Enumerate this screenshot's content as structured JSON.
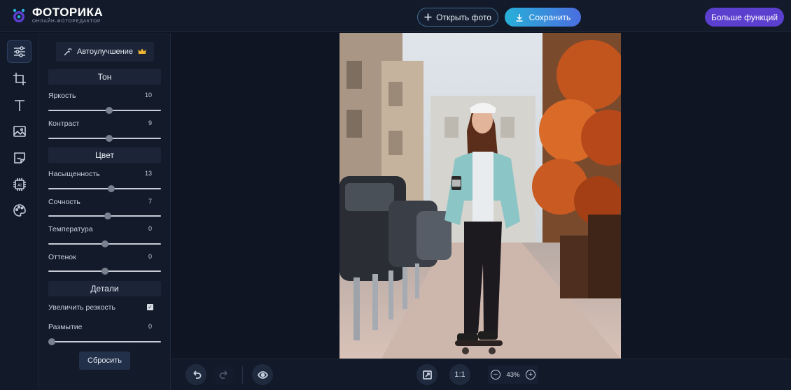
{
  "brand": {
    "title": "ФОТОРИКА",
    "subtitle": "ОНЛАЙН-ФОТОРЕДАКТОР"
  },
  "header": {
    "open_label": "Открыть фото",
    "save_label": "Сохранить",
    "more_label": "Больше функций"
  },
  "tools": [
    {
      "name": "adjustments",
      "icon": "sliders-icon",
      "active": true
    },
    {
      "name": "crop",
      "icon": "crop-icon"
    },
    {
      "name": "text",
      "icon": "text-icon"
    },
    {
      "name": "image",
      "icon": "image-icon"
    },
    {
      "name": "sticker",
      "icon": "sticker-icon"
    },
    {
      "name": "ai",
      "icon": "ai-chip-icon"
    },
    {
      "name": "effects",
      "icon": "palette-icon"
    }
  ],
  "panel": {
    "auto_label": "Автоулучшение",
    "sections": {
      "tone": "Тон",
      "color": "Цвет",
      "details": "Детали"
    },
    "controls": {
      "brightness": {
        "label": "Яркость",
        "value": 10,
        "fraction": 0.54
      },
      "contrast": {
        "label": "Контраст",
        "value": 9,
        "fraction": 0.54
      },
      "saturation": {
        "label": "Насыщенность",
        "value": 13,
        "fraction": 0.56
      },
      "vibrance": {
        "label": "Сочность",
        "value": 7,
        "fraction": 0.53
      },
      "temperature": {
        "label": "Температура",
        "value": 0,
        "fraction": 0.5
      },
      "tint": {
        "label": "Оттенок",
        "value": 0,
        "fraction": 0.5
      },
      "sharpen": {
        "label": "Увеличить резкость",
        "checked": true
      },
      "blur": {
        "label": "Размытие",
        "value": 0,
        "fraction": 0.03
      }
    },
    "reset_label": "Сбросить"
  },
  "bottom": {
    "actual_size_label": "1:1",
    "zoom": "43%"
  },
  "colors": {
    "accent_gradient_start": "#27b0d8",
    "accent_gradient_end": "#4b6ee0",
    "more_button": "#5b3fcf",
    "background": "#0f1522",
    "panel": "#131b2b"
  }
}
